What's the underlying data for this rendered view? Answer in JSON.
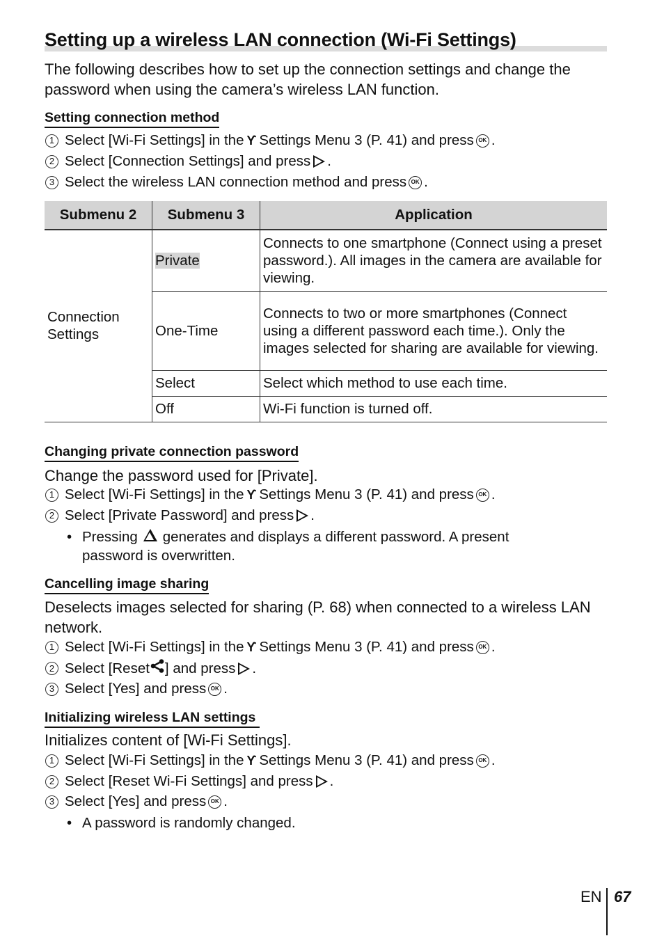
{
  "title": "Setting up a wireless LAN connection (Wi-Fi Settings)",
  "intro": "The following describes how to set up the connection settings and change the password when using the camera’s wireless LAN function.",
  "sections": {
    "connection_method": {
      "heading": "Setting connection method",
      "steps": [
        {
          "num": "1",
          "pre": "Select [Wi-Fi Settings] in the",
          "post": "Settings Menu 3 (P. 41) and press",
          "end": "."
        },
        {
          "num": "2",
          "pre": "Select [Connection Settings] and press",
          "end": "."
        },
        {
          "num": "3",
          "pre": "Select the wireless LAN connection method and press",
          "end": "."
        }
      ]
    },
    "table": {
      "headers": [
        "Submenu 2",
        "Submenu 3",
        "Application"
      ],
      "group_label": "Connection Settings",
      "rows": [
        {
          "submenu3": "Private",
          "application": "Connects to one smartphone (Connect using a preset password.). All images in the camera are available for viewing."
        },
        {
          "submenu3": "One-Time",
          "application": "Connects to two or more smartphones (Connect using a different password each time.). Only the images selected for sharing are available for viewing."
        },
        {
          "submenu3": "Select",
          "application": "Select which method to use each time."
        },
        {
          "submenu3": "Off",
          "application": "Wi-Fi function is turned off."
        }
      ]
    },
    "private_password": {
      "heading": "Changing private connection password",
      "desc": "Change the password used for [Private].",
      "steps": [
        {
          "num": "1",
          "pre": "Select [Wi-Fi Settings] in the",
          "post": "Settings Menu 3 (P. 41) and press",
          "end": "."
        },
        {
          "num": "2",
          "pre": "Select [Private Password] and press",
          "end": "."
        }
      ],
      "bullet_pre": "Pressing",
      "bullet_post": "generates and displays a different password. A present password is overwritten."
    },
    "cancel_sharing": {
      "heading": "Cancelling image sharing",
      "desc": "Deselects images selected for sharing (P. 68) when connected to a wireless LAN network.",
      "steps": [
        {
          "num": "1",
          "pre": "Select [Wi-Fi Settings] in the",
          "post": "Settings Menu 3 (P. 41) and press",
          "end": "."
        },
        {
          "num": "2",
          "pre": "Select [Reset",
          "post": "] and press",
          "end": "."
        },
        {
          "num": "3",
          "pre": "Select [Yes] and press",
          "end": "."
        }
      ]
    },
    "initialize": {
      "heading": "Initializing wireless LAN settings",
      "desc": "Initializes content of [Wi-Fi Settings].",
      "steps": [
        {
          "num": "1",
          "pre": "Select [Wi-Fi Settings] in the",
          "post": "Settings Menu 3 (P. 41) and press",
          "end": "."
        },
        {
          "num": "2",
          "pre": "Select [Reset Wi-Fi Settings] and press",
          "end": "."
        },
        {
          "num": "3",
          "pre": "Select [Yes] and press",
          "end": "."
        }
      ],
      "bullet": "A password is randomly changed."
    }
  },
  "icons": {
    "ok": "OK",
    "wrench": "ϒ",
    "bullet": "•"
  },
  "footer": {
    "lang": "EN",
    "page": "67"
  }
}
